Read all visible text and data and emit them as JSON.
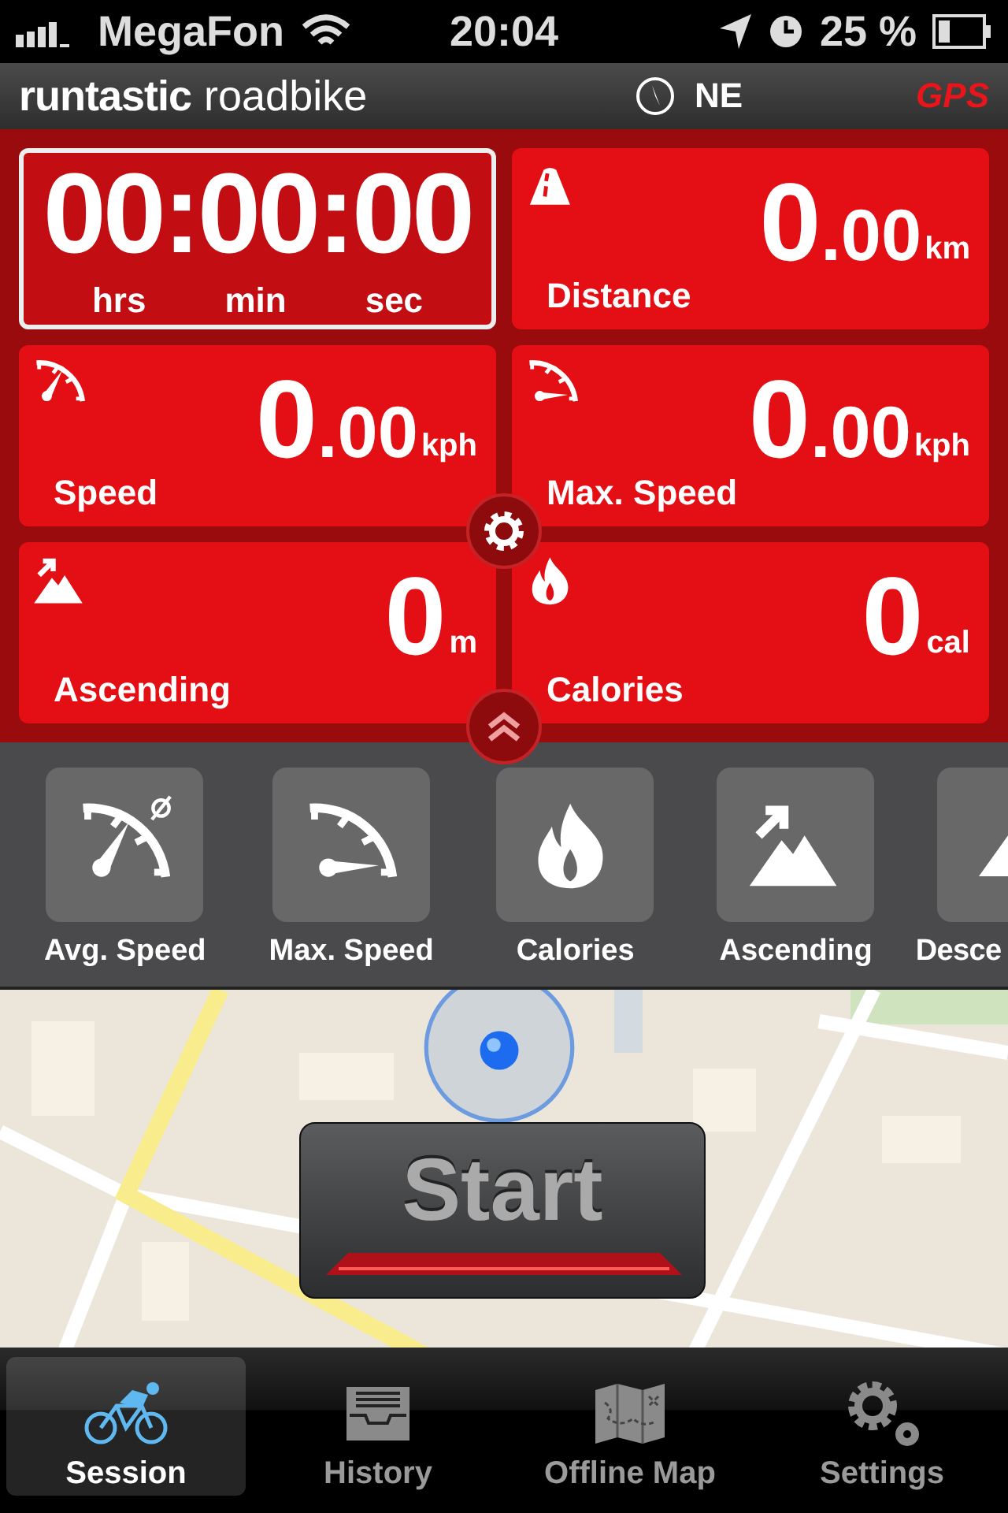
{
  "status_bar": {
    "carrier": "MegaFon",
    "time": "20:04",
    "battery": "25 %"
  },
  "header": {
    "brand": "runtastic",
    "product": "roadbike",
    "heading": "NE",
    "gps": "GPS"
  },
  "timer": {
    "value": "00:00:00",
    "units": [
      "hrs",
      "min",
      "sec"
    ]
  },
  "metrics": [
    {
      "value": "0",
      "decimals": ".00",
      "unit": "km",
      "label": "Distance"
    },
    {
      "value": "0",
      "decimals": ".00",
      "unit": "kph",
      "label": "Speed"
    },
    {
      "value": "0",
      "decimals": ".00",
      "unit": "kph",
      "label": "Max. Speed"
    },
    {
      "value": "0",
      "unit": "m",
      "label": "Ascending"
    },
    {
      "value": "0",
      "unit": "cal",
      "label": "Calories"
    }
  ],
  "selectors": [
    {
      "label": "Avg. Speed"
    },
    {
      "label": "Max. Speed"
    },
    {
      "label": "Calories"
    },
    {
      "label": "Ascending"
    },
    {
      "label": "Desce"
    }
  ],
  "start_button": {
    "label": "Start"
  },
  "tabs": [
    {
      "label": "Session",
      "selected": true
    },
    {
      "label": "History",
      "selected": false
    },
    {
      "label": "Offline Map",
      "selected": false
    },
    {
      "label": "Settings",
      "selected": false
    }
  ]
}
